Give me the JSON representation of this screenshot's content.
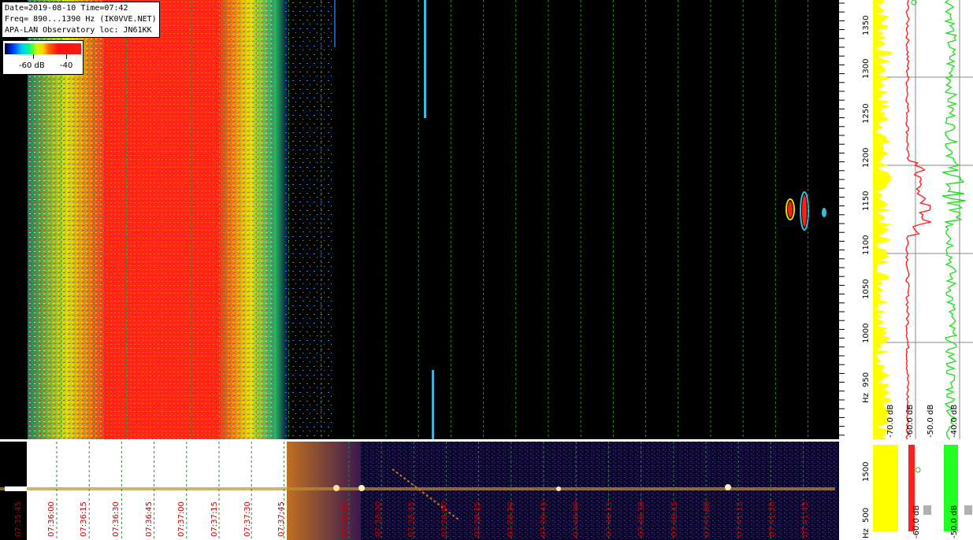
{
  "header": {
    "line1": "Date=2019-08-10 Time=07:42",
    "line2": "Freq= 890...1390 Hz (IK0VVE.NET)",
    "line3": "APA-LAN Observatory loc: JN61KK"
  },
  "colorbar": {
    "label_low": "-60 dB",
    "label_high": "-40"
  },
  "freq_axis": {
    "ticks": [
      "1350",
      "1300",
      "1250",
      "1200",
      "1150",
      "1100",
      "1050",
      "1000",
      "950"
    ],
    "unit": "Hz"
  },
  "lower_freq_axis": {
    "ticks": [
      "1500",
      "500"
    ],
    "unit": "Hz"
  },
  "spectrum_labels": {
    "yellow_db": "-70.0 dB",
    "red_db": "-60.0 dB",
    "green_db1": "-50.0 dB",
    "green_db2": "-40.0 dB",
    "lower_red_db": "-60.0 dB",
    "lower_green_db": "-50.0 dB"
  },
  "time_labels": [
    "07:35:45",
    "07:36:00",
    "07:36:15",
    "07:36:30",
    "07:36:45",
    "07:37:00",
    "07:37:15",
    "07:37:30",
    "07:37:45",
    "07:38:15",
    "07:38:30",
    "07:38:45",
    "07:39:00",
    "07:39:15",
    "07:39:30",
    "07:39:45",
    "07:40:00",
    "07:40:15",
    "07:40:30",
    "07:40:45",
    "07:41:00",
    "07:41:15",
    "07:41:30",
    "07:41:45"
  ],
  "colors": {
    "grid": "#2a8c2a",
    "label_red": "#c00000",
    "spectrum_yellow": "#ffff00",
    "spectrum_red": "#ff2020",
    "spectrum_green": "#20ff20"
  }
}
